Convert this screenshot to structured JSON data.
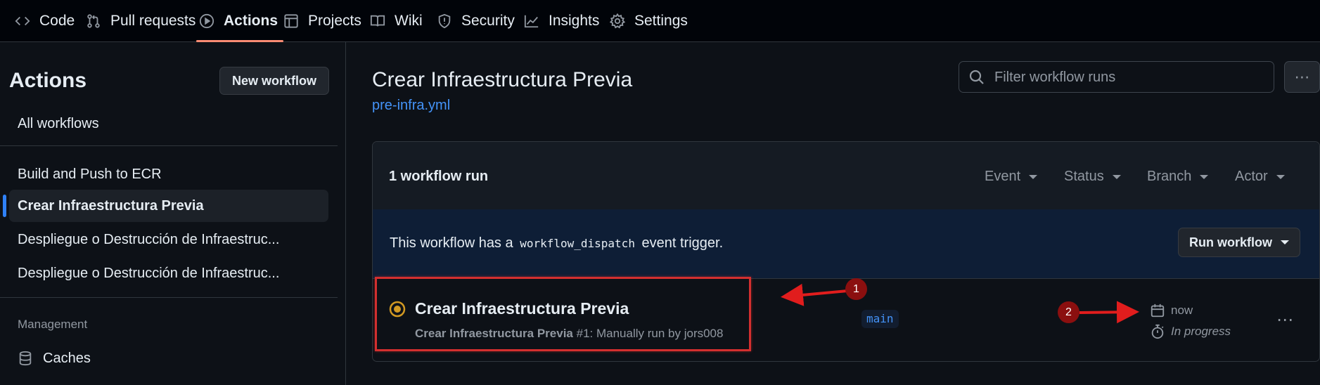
{
  "nav": {
    "tabs": [
      {
        "label": "Code",
        "icon": "code-icon"
      },
      {
        "label": "Pull requests",
        "icon": "pull-request-icon"
      },
      {
        "label": "Actions",
        "icon": "play-icon",
        "active": true
      },
      {
        "label": "Projects",
        "icon": "table-icon"
      },
      {
        "label": "Wiki",
        "icon": "book-icon"
      },
      {
        "label": "Security",
        "icon": "shield-icon"
      },
      {
        "label": "Insights",
        "icon": "graph-icon"
      },
      {
        "label": "Settings",
        "icon": "gear-icon"
      }
    ]
  },
  "sidebar": {
    "title": "Actions",
    "new_workflow_label": "New workflow",
    "all_workflows_label": "All workflows",
    "workflows": [
      {
        "label": "Build and Push to ECR"
      },
      {
        "label": "Crear Infraestructura Previa",
        "selected": true
      },
      {
        "label": "Despliegue o Destrucción de Infraestruc..."
      },
      {
        "label": "Despliegue o Destrucción de Infraestruc..."
      }
    ],
    "management_heading": "Management",
    "management_items": [
      {
        "label": "Caches",
        "icon": "database-icon"
      }
    ]
  },
  "main": {
    "title": "Crear Infraestructura Previa",
    "file_link": "pre-infra.yml",
    "filter_placeholder": "Filter workflow runs",
    "run_count": "1 workflow run",
    "filters": [
      "Event",
      "Status",
      "Branch",
      "Actor"
    ],
    "dispatch": {
      "text_before": "This workflow has a",
      "code": "workflow_dispatch",
      "text_after": "event trigger."
    },
    "run_workflow_label": "Run workflow",
    "run": {
      "title": "Crear Infraestructura Previa",
      "workflow_name": "Crear Infraestructura Previa",
      "meta": "#1: Manually run by jors008",
      "branch": "main",
      "time": "now",
      "status_text": "In progress",
      "status": "in_progress"
    }
  },
  "annotations": {
    "marker_1": "1",
    "marker_2": "2",
    "color": "#d32f2f"
  },
  "colors": {
    "accent": "#fd8c73",
    "link": "#4493f8",
    "in_progress": "#d29922"
  }
}
